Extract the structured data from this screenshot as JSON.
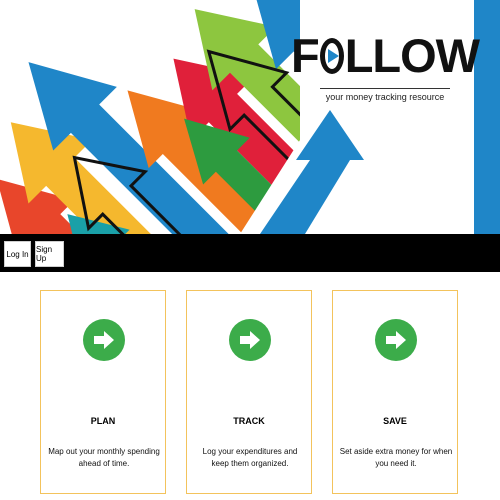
{
  "brand": {
    "logo_text": "FOLLOW",
    "tagline": "your money tracking resource"
  },
  "nav": {
    "login_label": "Log In",
    "signup_label": "Sign Up"
  },
  "cards": [
    {
      "title": "PLAN",
      "description": "Map out your monthly spending ahead of time.",
      "icon": "arrow-right-icon"
    },
    {
      "title": "TRACK",
      "description": "Log your expenditures and keep them organized.",
      "icon": "arrow-right-icon"
    },
    {
      "title": "SAVE",
      "description": "Set aside extra money for when you need it.",
      "icon": "arrow-right-icon"
    }
  ],
  "colors": {
    "accent_blue": "#1f86c8",
    "nav_bar": "#000000",
    "card_border": "#f3c35c",
    "icon_green": "#3cac4a"
  }
}
